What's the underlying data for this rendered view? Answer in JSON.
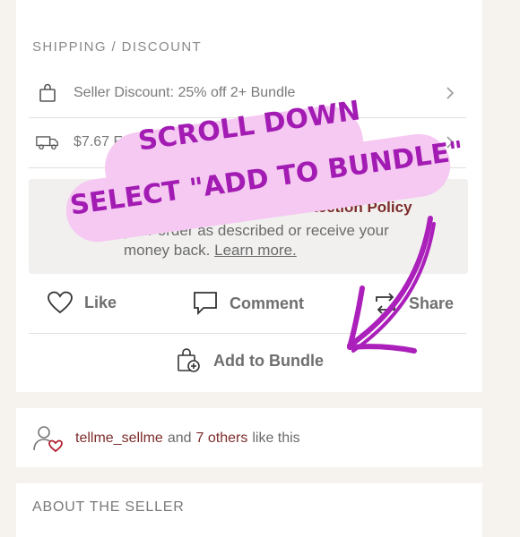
{
  "section": {
    "title": "SHIPPING / DISCOUNT"
  },
  "rows": [
    {
      "icon": "shopping-bag-icon",
      "text": "Seller Discount: 25% off 2+ Bundle"
    },
    {
      "icon": "truck-icon",
      "text": "$7.67 Expedited ("
    }
  ],
  "policy": {
    "title": "rotection Policy",
    "line1": "your order as described or receive your",
    "line2_prefix": "money back. ",
    "learn_more": "Learn more."
  },
  "actions": [
    {
      "icon": "heart-icon",
      "label": "Like"
    },
    {
      "icon": "comment-icon",
      "label": "Comment"
    },
    {
      "icon": "share-icon",
      "label": "Share"
    }
  ],
  "bundle": {
    "icon": "add-to-bundle-icon",
    "label": "Add to Bundle"
  },
  "likes": {
    "user": "tellme_sellme",
    "and": "and",
    "others": "7 others",
    "suffix": "like this"
  },
  "about": {
    "title": "ABOUT THE SELLER"
  },
  "overlay": {
    "line1": "SCROLL DOWN",
    "line2": "SELECT \"ADD TO BUNDLE\"",
    "color": "#a21bb3",
    "bubble_color": "#f5c9f1"
  },
  "colors": {
    "accent": "#7d2b2b",
    "background": "#f6f3ef"
  }
}
